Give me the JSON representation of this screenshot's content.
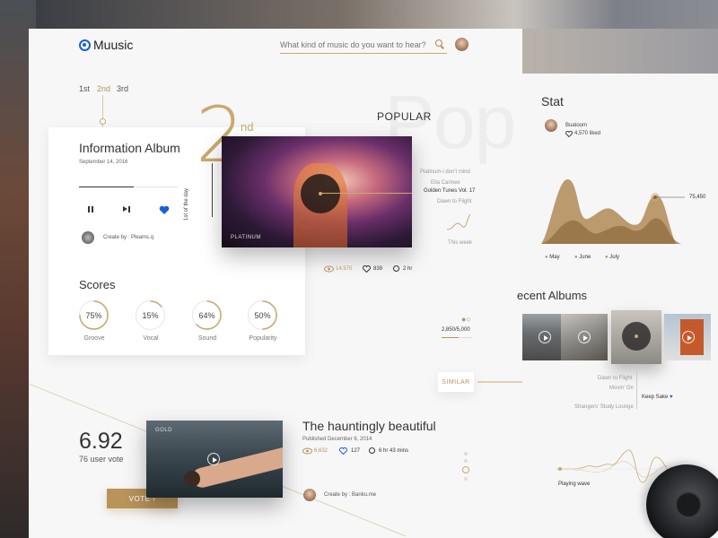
{
  "app": {
    "name": "Muusic"
  },
  "search": {
    "placeholder": "What kind of music do you want to hear?"
  },
  "ranks": [
    "1st",
    "2nd",
    "3rd"
  ],
  "info_album": {
    "title": "Information Album",
    "date": "September 14, 2016",
    "creator": "Create by : Pleams.q",
    "progress": 0.55
  },
  "big_rank": {
    "number": "2",
    "suffix": "nd",
    "side_label": "1st of the day"
  },
  "scores": {
    "title": "Scores",
    "items": [
      {
        "value": "75%",
        "label": "Groove",
        "pct": 75
      },
      {
        "value": "15%",
        "label": "Vocal",
        "pct": 15
      },
      {
        "value": "64%",
        "label": "Sound",
        "pct": 64
      },
      {
        "value": "50%",
        "label": "Popularity",
        "pct": 50
      }
    ]
  },
  "popular": {
    "title": "POPULAR",
    "bg_text": "Pop",
    "badge": "PLATINUM",
    "tracks": [
      "Platinum-i don't mind",
      "Ella Carinee",
      "Golden Tunes Vol. 17",
      "Dawn to Flight"
    ],
    "this_week": "This week",
    "views": "14,570",
    "likes": "839",
    "duration": "2 hr"
  },
  "followers": {
    "count": "2,850/5,000"
  },
  "similar": {
    "label": "SIMILAR"
  },
  "rating": {
    "value": "6.92",
    "votes": "76 user vote",
    "vote_button": "VOTE ›"
  },
  "featured": {
    "badge": "GOLD",
    "title": "The hauntingly beautiful",
    "published": "Published December 6, 2014",
    "views": "6,632",
    "likes": "127",
    "duration": "6 hr 43 mins",
    "creator": "Create by : Banku.me"
  },
  "stat": {
    "title": "Stat",
    "user": "Buatoom",
    "liked": "4,570 liked",
    "value_label": "75,450",
    "legend": [
      "May",
      "June",
      "July"
    ]
  },
  "recent": {
    "title": "Recent Albums",
    "title_visible": "ecent Albums",
    "tracks": [
      "Dawn to Flight",
      "Movin' On",
      "Keep Sake",
      "Strangers' Study Lounge"
    ],
    "wave_label": "Playing wave"
  },
  "colors": {
    "accent": "#b8935a",
    "blue": "#1b5fd6"
  }
}
